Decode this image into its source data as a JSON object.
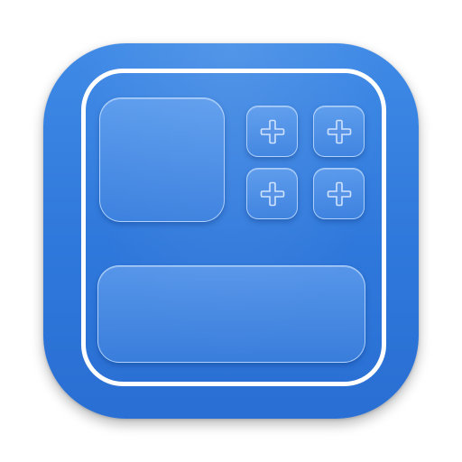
{
  "app_icon": {
    "name": "widget-grid-app",
    "background_color": "#3380de",
    "border_color": "#ffffff",
    "tile_outline_color": "#bedcff",
    "large_tile": {
      "icon": "none"
    },
    "small_tiles": [
      {
        "icon": "plus-icon"
      },
      {
        "icon": "plus-icon"
      },
      {
        "icon": "plus-icon"
      },
      {
        "icon": "plus-icon"
      }
    ],
    "wide_tile": {
      "icon": "none"
    }
  }
}
